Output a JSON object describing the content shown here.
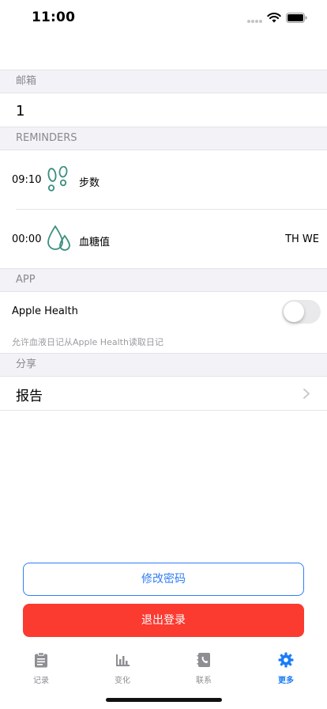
{
  "status_bar": {
    "time": "11:00"
  },
  "email_section": {
    "header": "邮箱",
    "value": "1"
  },
  "reminders_section": {
    "header": "REMINDERS",
    "items": [
      {
        "time": "09:10",
        "label": "步数",
        "icon": "footprints-icon",
        "days": ""
      },
      {
        "time": "00:00",
        "label": "血糖值",
        "icon": "blood-drop-icon",
        "days": "TH WE"
      }
    ]
  },
  "app_section": {
    "header": "APP",
    "apple_health_label": "Apple Health",
    "apple_health_enabled": false,
    "note": "允许血液日记从Apple Health读取日记"
  },
  "share_section": {
    "header": "分享",
    "report_label": "报告"
  },
  "buttons": {
    "change_password": "修改密码",
    "logout": "退出登录"
  },
  "tabbar": {
    "tabs": [
      {
        "label": "记录",
        "icon": "clipboard-icon",
        "active": false
      },
      {
        "label": "变化",
        "icon": "bar-chart-icon",
        "active": false
      },
      {
        "label": "联系",
        "icon": "contact-book-icon",
        "active": false
      },
      {
        "label": "更多",
        "icon": "gear-icon",
        "active": true
      }
    ]
  },
  "colors": {
    "accent": "#1b7cf6",
    "danger": "#fb3a30",
    "icon_teal": "#3a8f7d",
    "section_bg": "#f2f2f7"
  }
}
